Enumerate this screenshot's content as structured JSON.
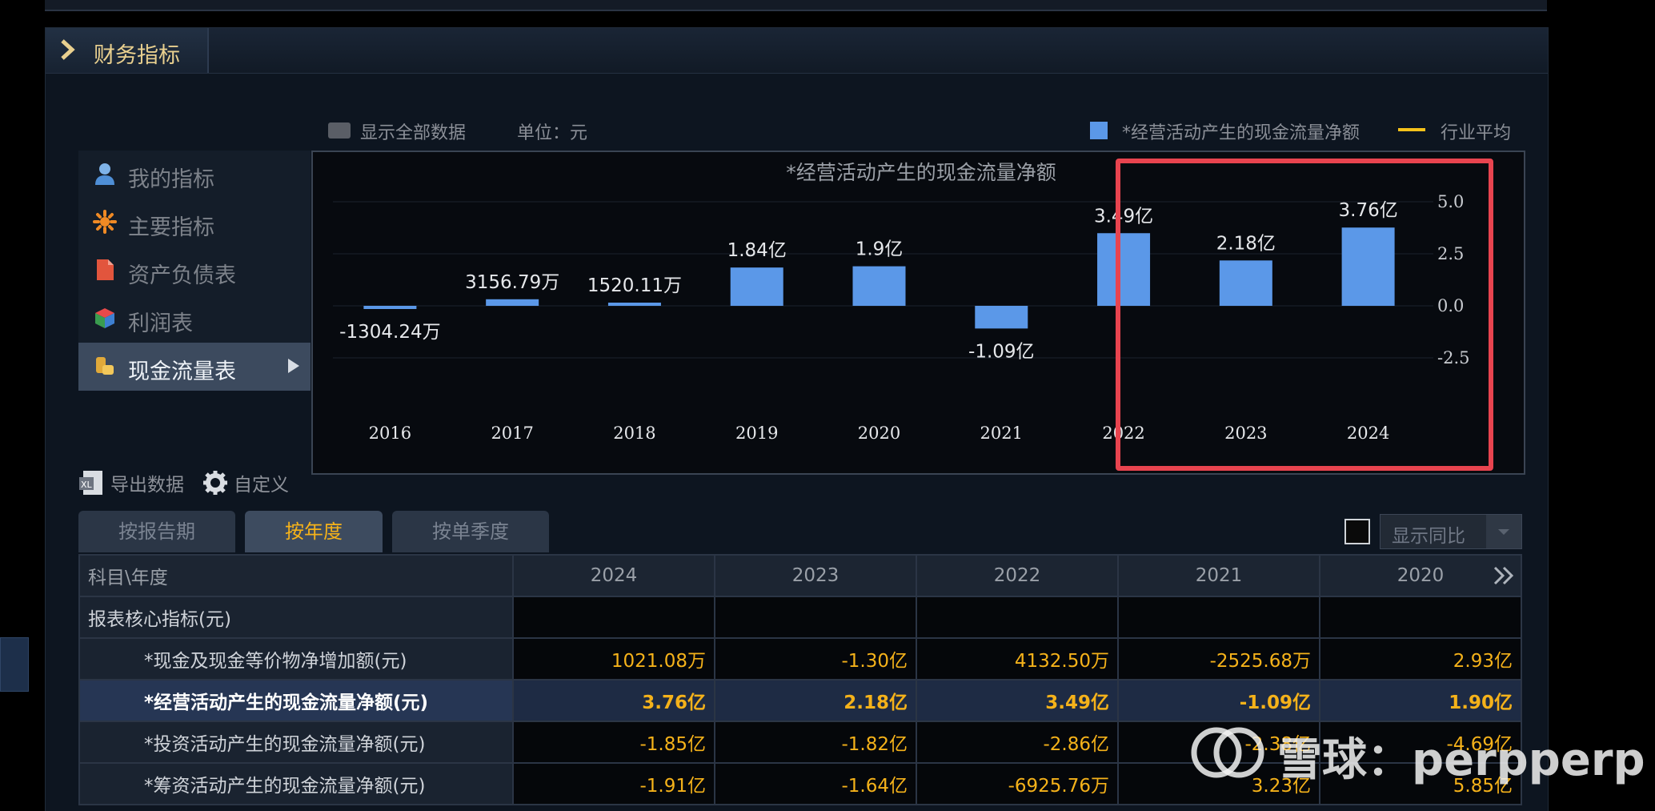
{
  "panel": {
    "title": "财务指标"
  },
  "toolbar": {
    "show_all": "显示全部数据",
    "unit": "单位：元",
    "legend_series": "*经营活动产生的现金流量净额",
    "legend_avg": "行业平均"
  },
  "nav": {
    "items": [
      {
        "label": "我的指标"
      },
      {
        "label": "主要指标"
      },
      {
        "label": "资产负债表"
      },
      {
        "label": "利润表"
      },
      {
        "label": "现金流量表"
      }
    ]
  },
  "chart_data": {
    "type": "bar",
    "title": "*经营活动产生的现金流量净额",
    "categories": [
      "2016",
      "2017",
      "2018",
      "2019",
      "2020",
      "2021",
      "2022",
      "2023",
      "2024"
    ],
    "values": [
      -0.1304,
      0.3157,
      0.152,
      1.84,
      1.9,
      -1.09,
      3.49,
      2.18,
      3.76
    ],
    "data_labels": [
      "-1304.24万",
      "3156.79万",
      "1520.11万",
      "1.84亿",
      "1.9亿",
      "-1.09亿",
      "3.49亿",
      "2.18亿",
      "3.76亿"
    ],
    "yticks": [
      "5.0",
      "2.5",
      "0.0",
      "-2.5"
    ],
    "ylim": [
      -5,
      5
    ],
    "series_color": "#5b98e8",
    "highlight_color": "#e8444f"
  },
  "actions": {
    "export": "导出数据",
    "customize": "自定义"
  },
  "tabs": [
    {
      "label": "按报告期"
    },
    {
      "label": "按年度"
    },
    {
      "label": "按单季度"
    }
  ],
  "compare": {
    "label": "显示同比"
  },
  "table": {
    "corner": "科目\\年度",
    "years": [
      "2024",
      "2023",
      "2022",
      "2021",
      "2020"
    ],
    "section": "报表核心指标(元)",
    "rows": [
      {
        "label": "*现金及现金等价物净增加额(元)",
        "values": [
          "1021.08万",
          "-1.30亿",
          "4132.50万",
          "-2525.68万",
          "2.93亿"
        ]
      },
      {
        "label": "*经营活动产生的现金流量净额(元)",
        "values": [
          "3.76亿",
          "2.18亿",
          "3.49亿",
          "-1.09亿",
          "1.90亿"
        ]
      },
      {
        "label": "*投资活动产生的现金流量净额(元)",
        "values": [
          "-1.85亿",
          "-1.82亿",
          "-2.86亿",
          "-2.38亿",
          "-4.69亿"
        ]
      },
      {
        "label": "*筹资活动产生的现金流量净额(元)",
        "values": [
          "-1.91亿",
          "-1.64亿",
          "-6925.76万",
          "3.23亿",
          "5.85亿"
        ]
      }
    ]
  },
  "watermark": {
    "text": "雪球：perpperp"
  },
  "colors": {
    "accent": "#f5b21a",
    "title": "#e9d08f",
    "bar": "#5b98e8",
    "highlight": "#e8444f"
  }
}
